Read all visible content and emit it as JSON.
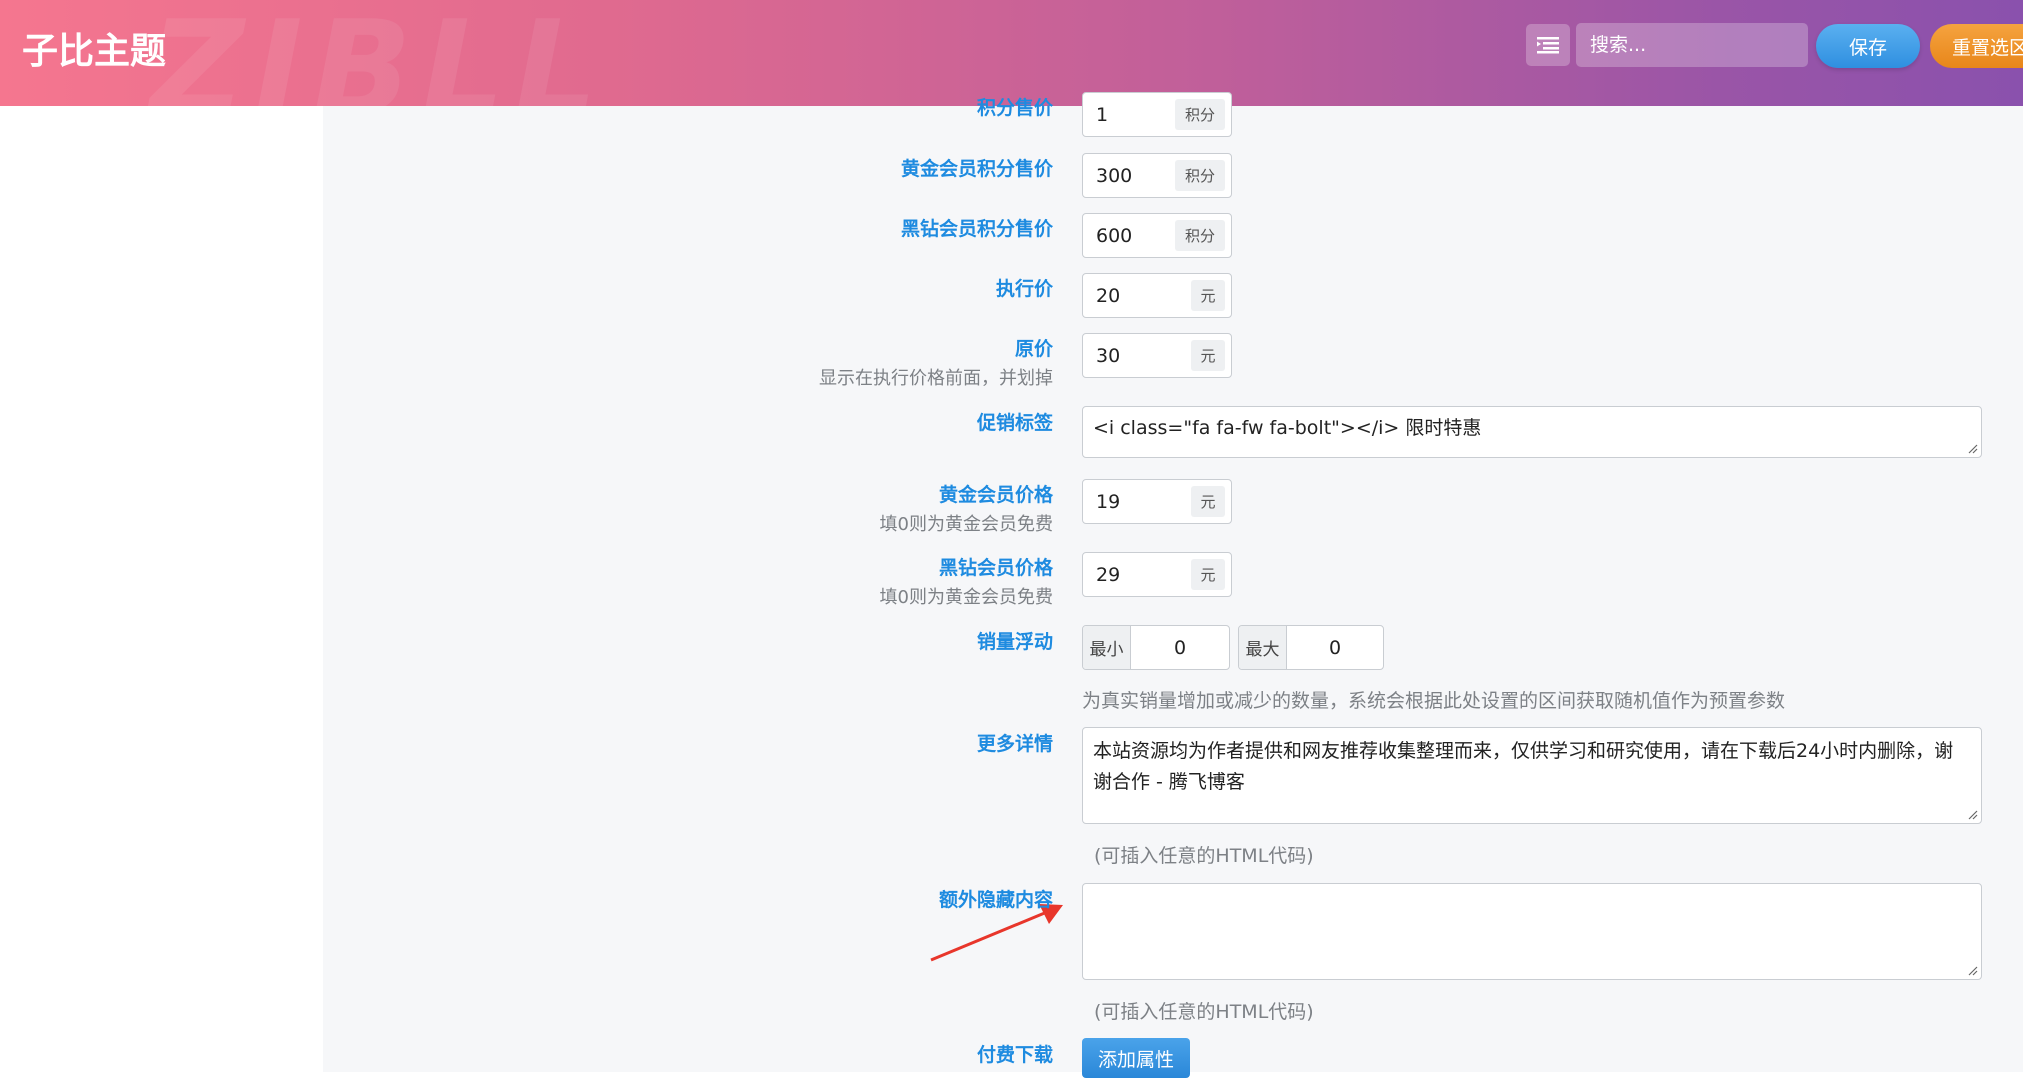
{
  "header": {
    "brand": "子比主题",
    "watermark": "ZIBLL",
    "search_placeholder": "搜索...",
    "save_label": "保存",
    "reset_label": "重置选区"
  },
  "form": {
    "points_price": {
      "label": "积分售价",
      "value": "1",
      "unit": "积分"
    },
    "gold_points_price": {
      "label": "黄金会员积分售价",
      "value": "300",
      "unit": "积分"
    },
    "diamond_points_price": {
      "label": "黑钻会员积分售价",
      "value": "600",
      "unit": "积分"
    },
    "exec_price": {
      "label": "执行价",
      "value": "20",
      "unit": "元"
    },
    "orig_price": {
      "label": "原价",
      "hint": "显示在执行价格前面，并划掉",
      "value": "30",
      "unit": "元"
    },
    "promo_tag": {
      "label": "促销标签",
      "value": "<i class=\"fa fa-fw fa-bolt\"></i> 限时特惠"
    },
    "gold_price": {
      "label": "黄金会员价格",
      "hint": "填0则为黄金会员免费",
      "value": "19",
      "unit": "元"
    },
    "diamond_price": {
      "label": "黑钻会员价格",
      "hint": "填0则为黄金会员免费",
      "value": "29",
      "unit": "元"
    },
    "sales_float": {
      "label": "销量浮动",
      "min_label": "最小",
      "min_value": "0",
      "max_label": "最大",
      "max_value": "0",
      "note": "为真实销量增加或减少的数量，系统会根据此处设置的区间获取随机值作为预置参数"
    },
    "more_details": {
      "label": "更多详情",
      "value": "本站资源均为作者提供和网友推荐收集整理而来，仅供学习和研究使用，请在下载后24小时内删除，谢谢合作 - 腾飞博客",
      "note": "(可插入任意的HTML代码)"
    },
    "hidden_content": {
      "label": "额外隐藏内容",
      "value": "",
      "note": "(可插入任意的HTML代码)"
    },
    "paid_download": {
      "label": "付费下载",
      "button": "添加属性"
    }
  },
  "colors": {
    "label": "#1e8be0",
    "annotation_arrow": "#e8362b"
  }
}
